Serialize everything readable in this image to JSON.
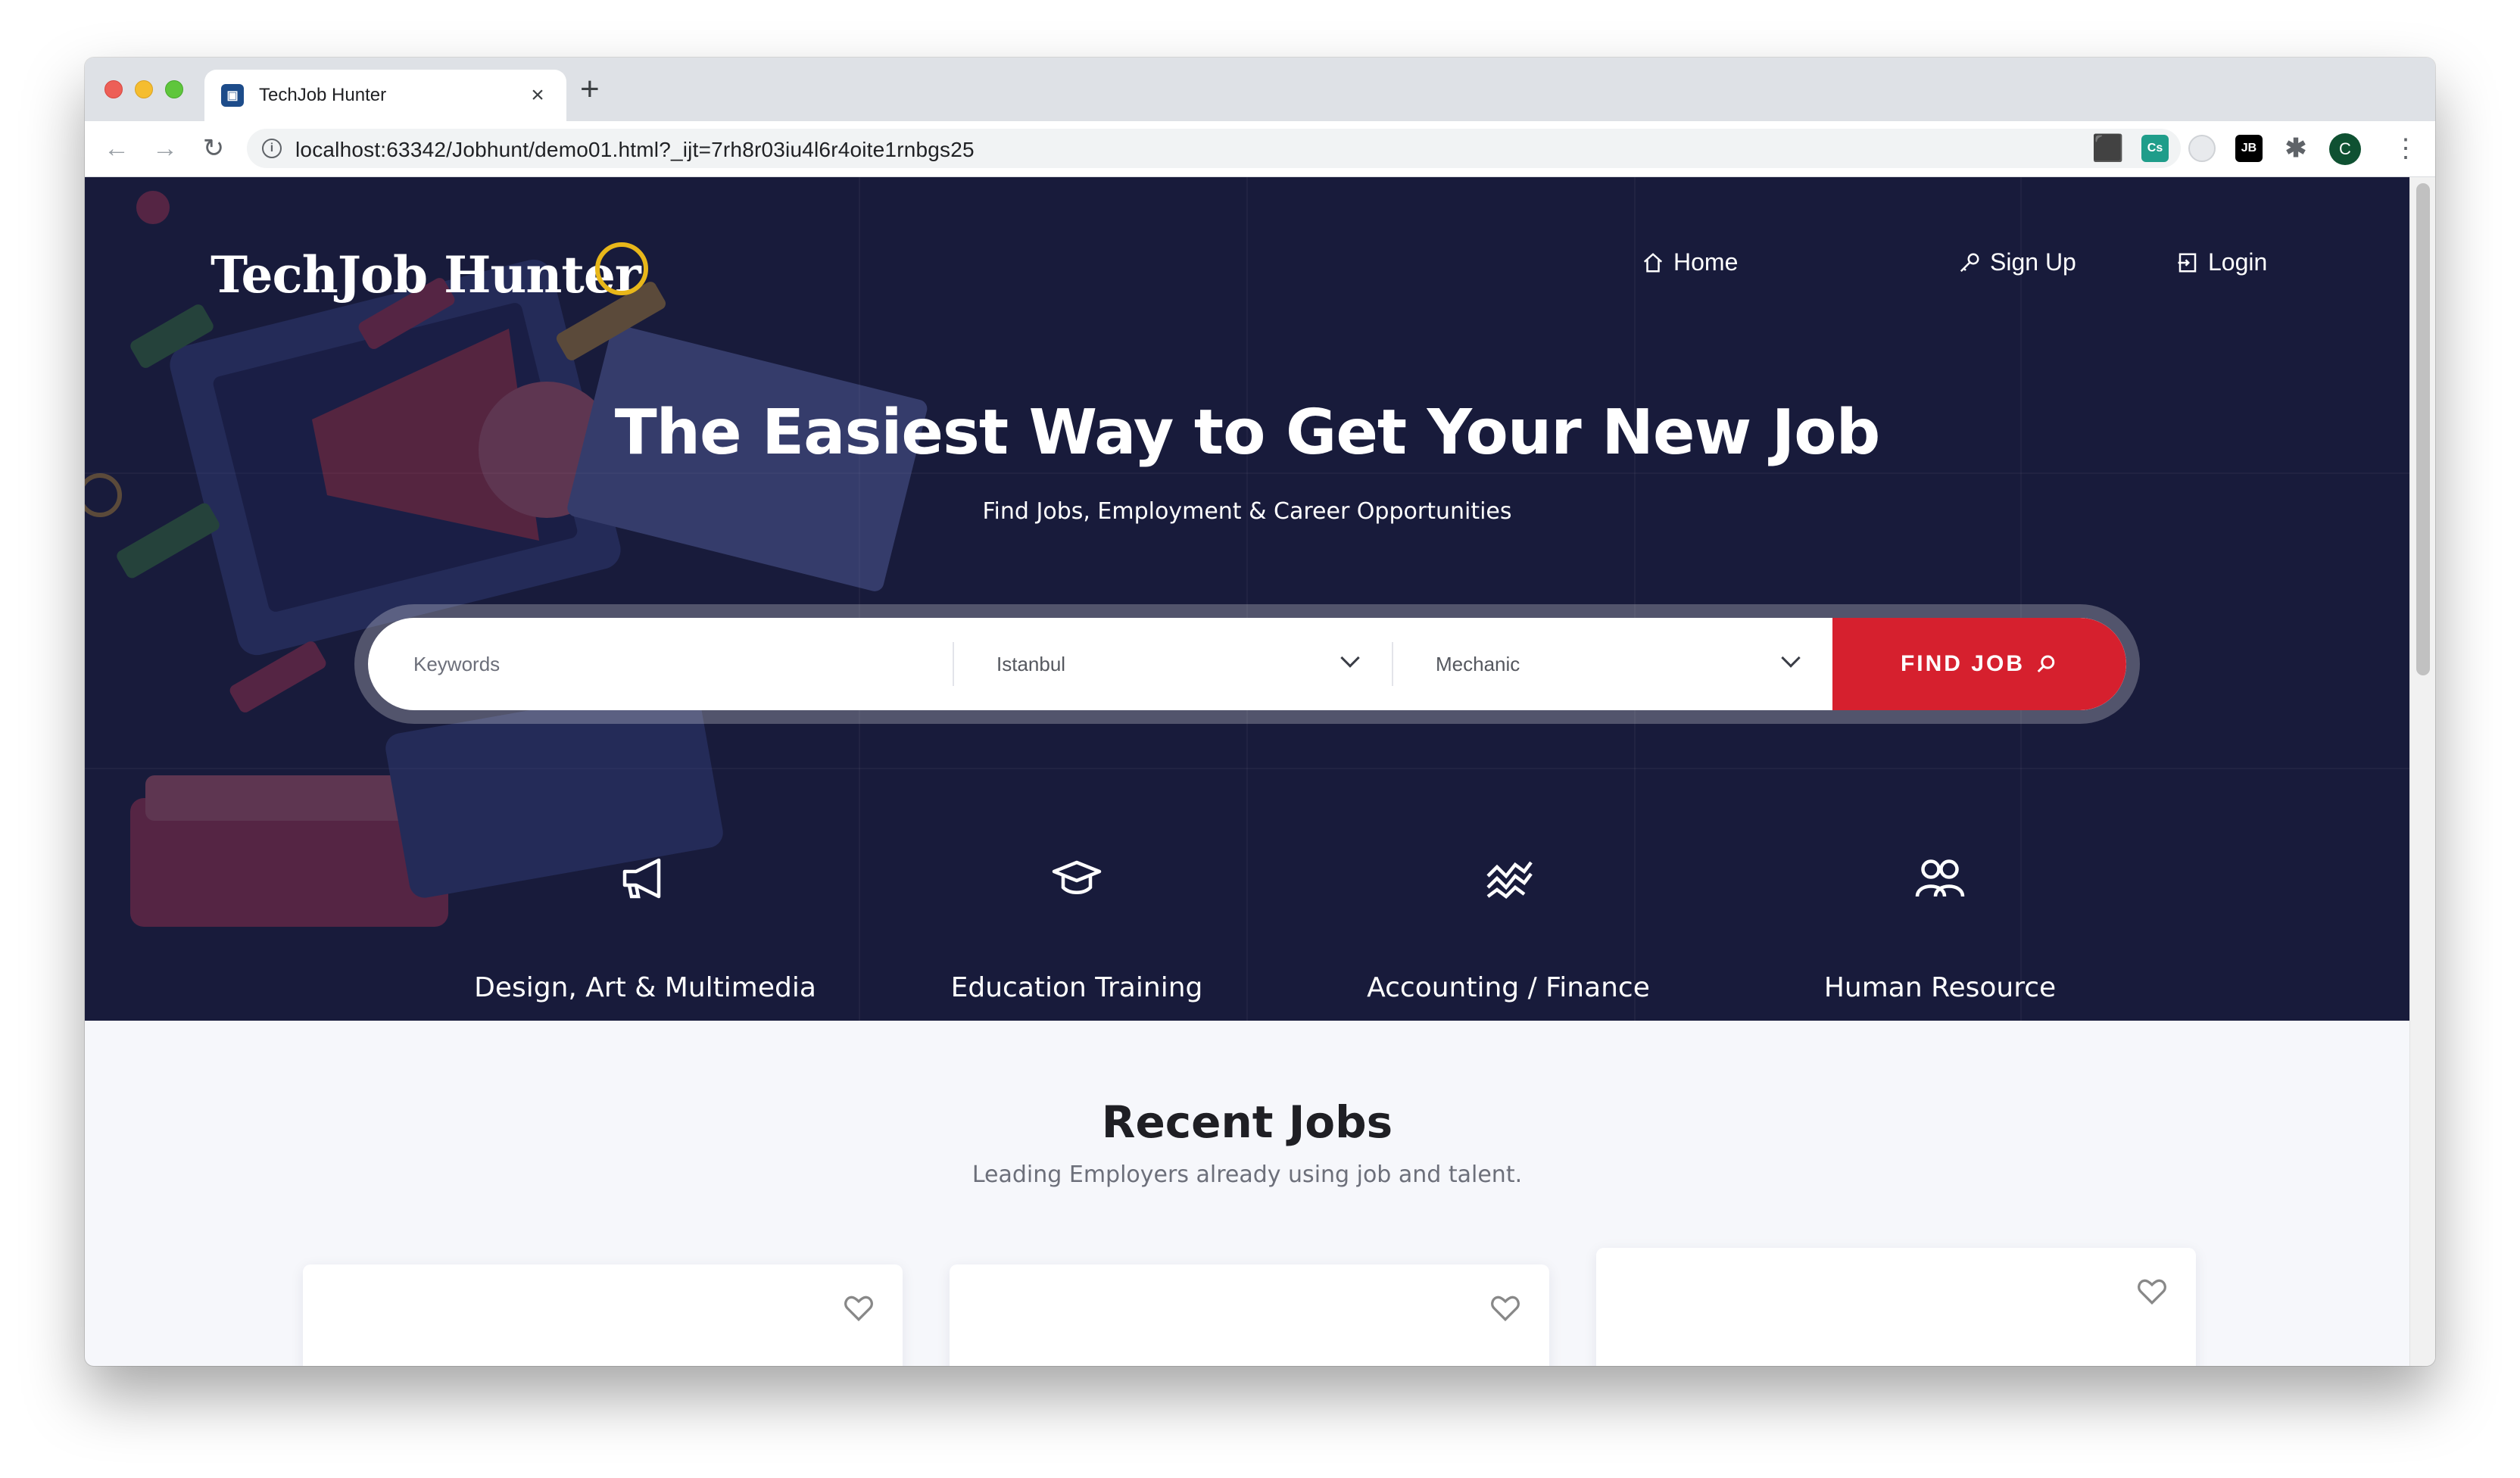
{
  "browser": {
    "tab_title": "TechJob Hunter",
    "tab_close": "×",
    "new_tab": "+",
    "url": "localhost:63342/Jobhunt/demo01.html?_ijt=7rh8r03iu4l6r4oite1rnbgs25",
    "profile_initial": "C",
    "info_icon": "i",
    "nav": {
      "back": "←",
      "forward": "→",
      "reload": "↻",
      "star": "☆",
      "menu": "⋮"
    }
  },
  "site": {
    "logo": "TechJob Hunter",
    "nav": {
      "home": "Home",
      "signup": "Sign Up",
      "login": "Login"
    }
  },
  "hero": {
    "headline": "The Easiest Way to Get Your New Job",
    "subheadline": "Find Jobs, Employment & Career Opportunities"
  },
  "search": {
    "keywords_placeholder": "Keywords",
    "location_selected": "Istanbul",
    "category_selected": "Mechanic",
    "find_button": "FIND JOB"
  },
  "categories": [
    {
      "label": "Design, Art & Multimedia",
      "icon": "megaphone-icon"
    },
    {
      "label": "Education Training",
      "icon": "graduation-cap-icon"
    },
    {
      "label": "Accounting / Finance",
      "icon": "finance-chart-icon"
    },
    {
      "label": "Human Resource",
      "icon": "people-icon"
    }
  ],
  "recent_jobs": {
    "title": "Recent Jobs",
    "subtitle": "Leading Employers already using job and talent."
  },
  "colors": {
    "hero_bg": "#181b3b",
    "accent_red": "#d6202e",
    "logo_ring": "#e8b71a"
  }
}
